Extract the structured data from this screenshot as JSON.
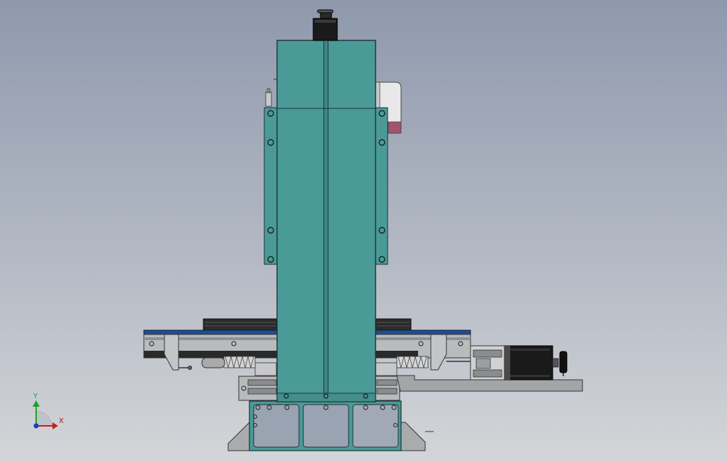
{
  "viewport": {
    "background_top": "#8f99ad",
    "background_bottom": "#d3d5d8",
    "model_colors": {
      "column": "#4a9a98",
      "column_edge": "#1c3232",
      "steel": "#9c9ea2",
      "steel_light": "#c8c9cb",
      "rail_blue": "#1f4e8c",
      "motor_black": "#1a1a1a",
      "handle_magenta": "#a05470"
    }
  },
  "triad": {
    "x_label": "X",
    "y_label": "Y",
    "x_color": "#c81e1e",
    "y_color": "#1ea028",
    "z_color": "#1e3cc8"
  }
}
